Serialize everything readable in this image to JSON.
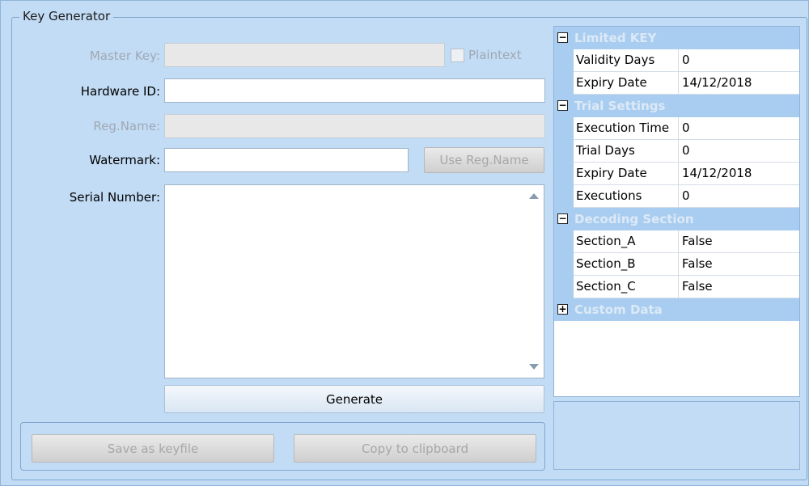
{
  "group_title": "Key Generator",
  "form": {
    "master_key_label": "Master Key:",
    "master_key_value": "",
    "plaintext_label": "Plaintext",
    "hardware_id_label": "Hardware ID:",
    "hardware_id_value": "",
    "reg_name_label": "Reg.Name:",
    "reg_name_value": "",
    "watermark_label": "Watermark:",
    "watermark_value": "",
    "use_reg_name_button": "Use Reg.Name",
    "serial_number_label": "Serial Number:",
    "generate_button": "Generate",
    "save_keyfile_button": "Save as keyfile",
    "copy_clipboard_button": "Copy to clipboard"
  },
  "grid": {
    "categories": [
      {
        "label": "Limited KEY",
        "toggle": "−",
        "rows": [
          {
            "name": "Validity Days",
            "value": "0"
          },
          {
            "name": "Expiry Date",
            "value": "14/12/2018"
          }
        ]
      },
      {
        "label": "Trial Settings",
        "toggle": "−",
        "rows": [
          {
            "name": "Execution Time",
            "value": "0"
          },
          {
            "name": "Trial Days",
            "value": "0"
          },
          {
            "name": "Expiry Date",
            "value": "14/12/2018"
          },
          {
            "name": "Executions",
            "value": "0"
          }
        ]
      },
      {
        "label": "Decoding Section",
        "toggle": "−",
        "rows": [
          {
            "name": "Section_A",
            "value": "False"
          },
          {
            "name": "Section_B",
            "value": "False"
          },
          {
            "name": "Section_C",
            "value": "False"
          }
        ]
      },
      {
        "label": "Custom Data",
        "toggle": "+",
        "rows": []
      }
    ]
  }
}
